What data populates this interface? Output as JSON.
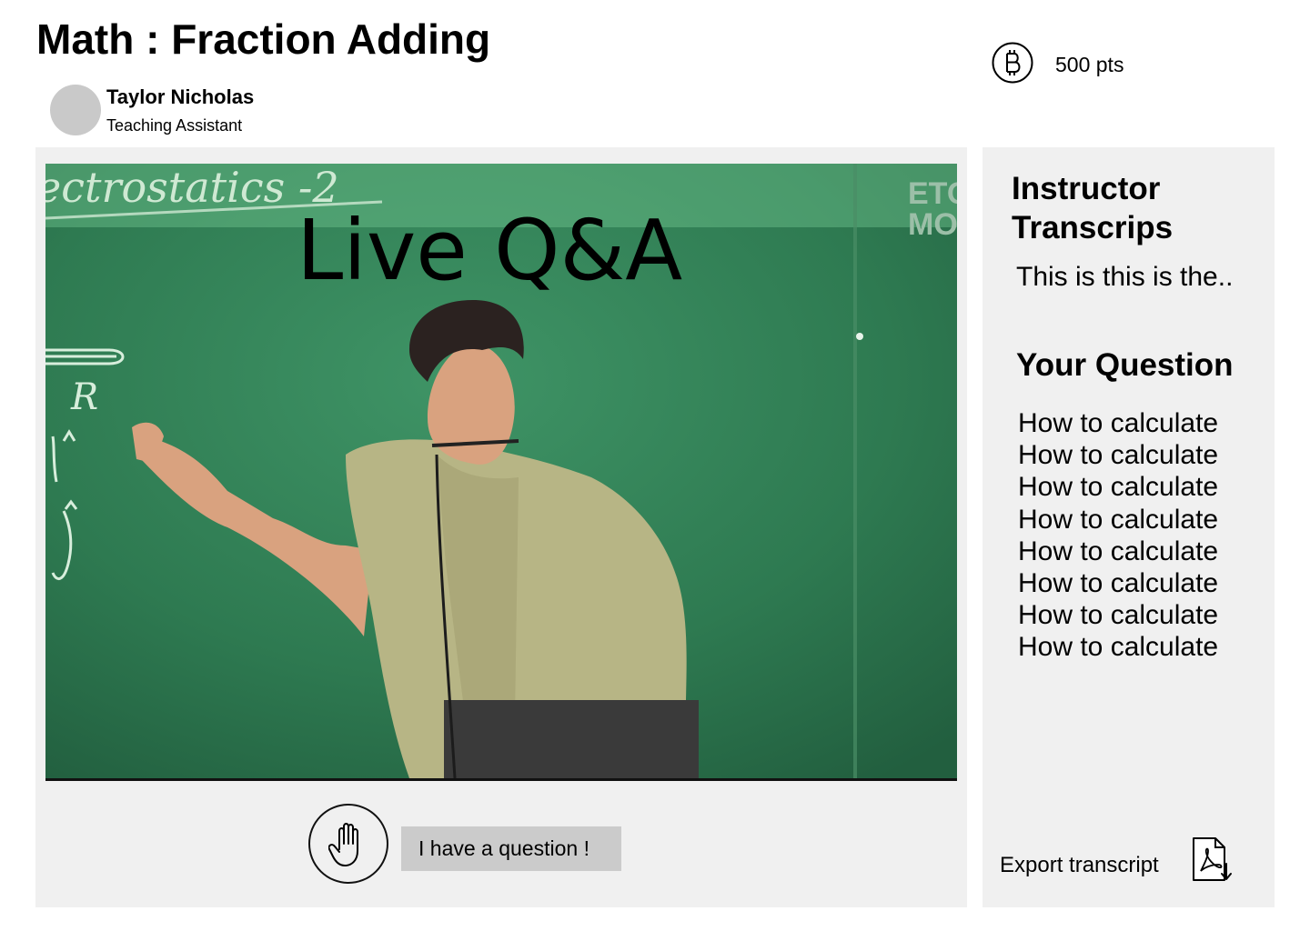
{
  "header": {
    "course_title": "Math : Fraction Adding",
    "ta_name": "Taylor Nicholas",
    "ta_role": "Teaching Assistant",
    "points": "500 pts",
    "points_icon": "bitcoin-icon"
  },
  "video": {
    "overlay_title": "Live Q&A",
    "board_heading": "ectrostatics -2",
    "board_letter_r": "R",
    "watermark_line1": "ETO",
    "watermark_line2": "MO"
  },
  "controls": {
    "raise_hand_icon": "raise-hand-icon",
    "question_button_label": "I have a question !"
  },
  "sidebar": {
    "transcript_heading": "Instructor Transcrips",
    "transcript_text": "This is this is the..",
    "question_heading": "Your Question",
    "questions": [
      "How to calculate",
      "How to calculate",
      "How to calculate",
      "How to calculate",
      "How to calculate",
      "How to calculate",
      "How to calculate",
      "How to calculate"
    ],
    "export_label": "Export transcript",
    "export_icon": "pdf-download-icon"
  },
  "colors": {
    "panel_bg": "#f0f0f0",
    "button_bg": "#cbcbcb",
    "board_green": "#2f7a52",
    "avatar": "#c9c9c9"
  }
}
